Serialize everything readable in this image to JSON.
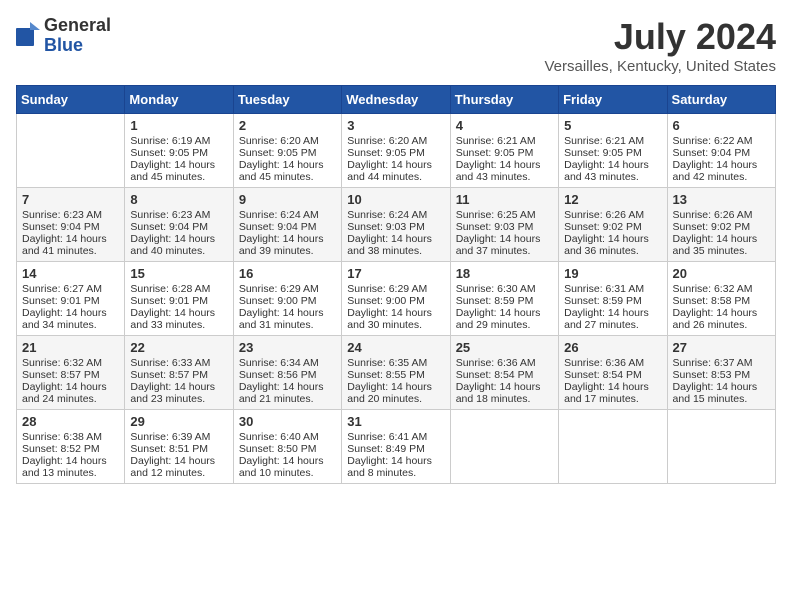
{
  "logo": {
    "general": "General",
    "blue": "Blue"
  },
  "title": "July 2024",
  "location": "Versailles, Kentucky, United States",
  "days_of_week": [
    "Sunday",
    "Monday",
    "Tuesday",
    "Wednesday",
    "Thursday",
    "Friday",
    "Saturday"
  ],
  "weeks": [
    [
      {
        "day": "",
        "info": ""
      },
      {
        "day": "1",
        "info": "Sunrise: 6:19 AM\nSunset: 9:05 PM\nDaylight: 14 hours and 45 minutes."
      },
      {
        "day": "2",
        "info": "Sunrise: 6:20 AM\nSunset: 9:05 PM\nDaylight: 14 hours and 45 minutes."
      },
      {
        "day": "3",
        "info": "Sunrise: 6:20 AM\nSunset: 9:05 PM\nDaylight: 14 hours and 44 minutes."
      },
      {
        "day": "4",
        "info": "Sunrise: 6:21 AM\nSunset: 9:05 PM\nDaylight: 14 hours and 43 minutes."
      },
      {
        "day": "5",
        "info": "Sunrise: 6:21 AM\nSunset: 9:05 PM\nDaylight: 14 hours and 43 minutes."
      },
      {
        "day": "6",
        "info": "Sunrise: 6:22 AM\nSunset: 9:04 PM\nDaylight: 14 hours and 42 minutes."
      }
    ],
    [
      {
        "day": "7",
        "info": "Sunrise: 6:23 AM\nSunset: 9:04 PM\nDaylight: 14 hours and 41 minutes."
      },
      {
        "day": "8",
        "info": "Sunrise: 6:23 AM\nSunset: 9:04 PM\nDaylight: 14 hours and 40 minutes."
      },
      {
        "day": "9",
        "info": "Sunrise: 6:24 AM\nSunset: 9:04 PM\nDaylight: 14 hours and 39 minutes."
      },
      {
        "day": "10",
        "info": "Sunrise: 6:24 AM\nSunset: 9:03 PM\nDaylight: 14 hours and 38 minutes."
      },
      {
        "day": "11",
        "info": "Sunrise: 6:25 AM\nSunset: 9:03 PM\nDaylight: 14 hours and 37 minutes."
      },
      {
        "day": "12",
        "info": "Sunrise: 6:26 AM\nSunset: 9:02 PM\nDaylight: 14 hours and 36 minutes."
      },
      {
        "day": "13",
        "info": "Sunrise: 6:26 AM\nSunset: 9:02 PM\nDaylight: 14 hours and 35 minutes."
      }
    ],
    [
      {
        "day": "14",
        "info": "Sunrise: 6:27 AM\nSunset: 9:01 PM\nDaylight: 14 hours and 34 minutes."
      },
      {
        "day": "15",
        "info": "Sunrise: 6:28 AM\nSunset: 9:01 PM\nDaylight: 14 hours and 33 minutes."
      },
      {
        "day": "16",
        "info": "Sunrise: 6:29 AM\nSunset: 9:00 PM\nDaylight: 14 hours and 31 minutes."
      },
      {
        "day": "17",
        "info": "Sunrise: 6:29 AM\nSunset: 9:00 PM\nDaylight: 14 hours and 30 minutes."
      },
      {
        "day": "18",
        "info": "Sunrise: 6:30 AM\nSunset: 8:59 PM\nDaylight: 14 hours and 29 minutes."
      },
      {
        "day": "19",
        "info": "Sunrise: 6:31 AM\nSunset: 8:59 PM\nDaylight: 14 hours and 27 minutes."
      },
      {
        "day": "20",
        "info": "Sunrise: 6:32 AM\nSunset: 8:58 PM\nDaylight: 14 hours and 26 minutes."
      }
    ],
    [
      {
        "day": "21",
        "info": "Sunrise: 6:32 AM\nSunset: 8:57 PM\nDaylight: 14 hours and 24 minutes."
      },
      {
        "day": "22",
        "info": "Sunrise: 6:33 AM\nSunset: 8:57 PM\nDaylight: 14 hours and 23 minutes."
      },
      {
        "day": "23",
        "info": "Sunrise: 6:34 AM\nSunset: 8:56 PM\nDaylight: 14 hours and 21 minutes."
      },
      {
        "day": "24",
        "info": "Sunrise: 6:35 AM\nSunset: 8:55 PM\nDaylight: 14 hours and 20 minutes."
      },
      {
        "day": "25",
        "info": "Sunrise: 6:36 AM\nSunset: 8:54 PM\nDaylight: 14 hours and 18 minutes."
      },
      {
        "day": "26",
        "info": "Sunrise: 6:36 AM\nSunset: 8:54 PM\nDaylight: 14 hours and 17 minutes."
      },
      {
        "day": "27",
        "info": "Sunrise: 6:37 AM\nSunset: 8:53 PM\nDaylight: 14 hours and 15 minutes."
      }
    ],
    [
      {
        "day": "28",
        "info": "Sunrise: 6:38 AM\nSunset: 8:52 PM\nDaylight: 14 hours and 13 minutes."
      },
      {
        "day": "29",
        "info": "Sunrise: 6:39 AM\nSunset: 8:51 PM\nDaylight: 14 hours and 12 minutes."
      },
      {
        "day": "30",
        "info": "Sunrise: 6:40 AM\nSunset: 8:50 PM\nDaylight: 14 hours and 10 minutes."
      },
      {
        "day": "31",
        "info": "Sunrise: 6:41 AM\nSunset: 8:49 PM\nDaylight: 14 hours and 8 minutes."
      },
      {
        "day": "",
        "info": ""
      },
      {
        "day": "",
        "info": ""
      },
      {
        "day": "",
        "info": ""
      }
    ]
  ]
}
